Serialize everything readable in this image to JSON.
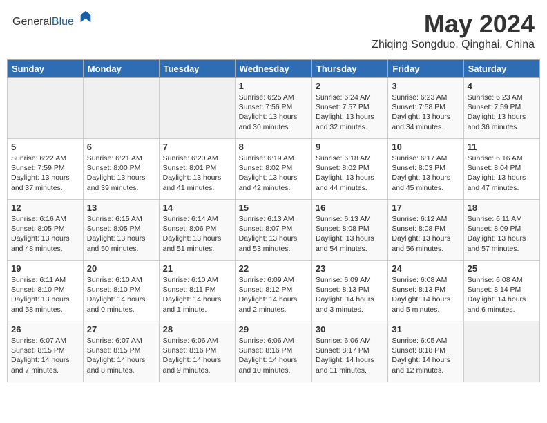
{
  "header": {
    "logo_general": "General",
    "logo_blue": "Blue",
    "month": "May 2024",
    "location": "Zhiqing Songduo, Qinghai, China"
  },
  "weekdays": [
    "Sunday",
    "Monday",
    "Tuesday",
    "Wednesday",
    "Thursday",
    "Friday",
    "Saturday"
  ],
  "weeks": [
    [
      {
        "day": "",
        "info": ""
      },
      {
        "day": "",
        "info": ""
      },
      {
        "day": "",
        "info": ""
      },
      {
        "day": "1",
        "info": "Sunrise: 6:25 AM\nSunset: 7:56 PM\nDaylight: 13 hours\nand 30 minutes."
      },
      {
        "day": "2",
        "info": "Sunrise: 6:24 AM\nSunset: 7:57 PM\nDaylight: 13 hours\nand 32 minutes."
      },
      {
        "day": "3",
        "info": "Sunrise: 6:23 AM\nSunset: 7:58 PM\nDaylight: 13 hours\nand 34 minutes."
      },
      {
        "day": "4",
        "info": "Sunrise: 6:23 AM\nSunset: 7:59 PM\nDaylight: 13 hours\nand 36 minutes."
      }
    ],
    [
      {
        "day": "5",
        "info": "Sunrise: 6:22 AM\nSunset: 7:59 PM\nDaylight: 13 hours\nand 37 minutes."
      },
      {
        "day": "6",
        "info": "Sunrise: 6:21 AM\nSunset: 8:00 PM\nDaylight: 13 hours\nand 39 minutes."
      },
      {
        "day": "7",
        "info": "Sunrise: 6:20 AM\nSunset: 8:01 PM\nDaylight: 13 hours\nand 41 minutes."
      },
      {
        "day": "8",
        "info": "Sunrise: 6:19 AM\nSunset: 8:02 PM\nDaylight: 13 hours\nand 42 minutes."
      },
      {
        "day": "9",
        "info": "Sunrise: 6:18 AM\nSunset: 8:02 PM\nDaylight: 13 hours\nand 44 minutes."
      },
      {
        "day": "10",
        "info": "Sunrise: 6:17 AM\nSunset: 8:03 PM\nDaylight: 13 hours\nand 45 minutes."
      },
      {
        "day": "11",
        "info": "Sunrise: 6:16 AM\nSunset: 8:04 PM\nDaylight: 13 hours\nand 47 minutes."
      }
    ],
    [
      {
        "day": "12",
        "info": "Sunrise: 6:16 AM\nSunset: 8:05 PM\nDaylight: 13 hours\nand 48 minutes."
      },
      {
        "day": "13",
        "info": "Sunrise: 6:15 AM\nSunset: 8:05 PM\nDaylight: 13 hours\nand 50 minutes."
      },
      {
        "day": "14",
        "info": "Sunrise: 6:14 AM\nSunset: 8:06 PM\nDaylight: 13 hours\nand 51 minutes."
      },
      {
        "day": "15",
        "info": "Sunrise: 6:13 AM\nSunset: 8:07 PM\nDaylight: 13 hours\nand 53 minutes."
      },
      {
        "day": "16",
        "info": "Sunrise: 6:13 AM\nSunset: 8:08 PM\nDaylight: 13 hours\nand 54 minutes."
      },
      {
        "day": "17",
        "info": "Sunrise: 6:12 AM\nSunset: 8:08 PM\nDaylight: 13 hours\nand 56 minutes."
      },
      {
        "day": "18",
        "info": "Sunrise: 6:11 AM\nSunset: 8:09 PM\nDaylight: 13 hours\nand 57 minutes."
      }
    ],
    [
      {
        "day": "19",
        "info": "Sunrise: 6:11 AM\nSunset: 8:10 PM\nDaylight: 13 hours\nand 58 minutes."
      },
      {
        "day": "20",
        "info": "Sunrise: 6:10 AM\nSunset: 8:10 PM\nDaylight: 14 hours\nand 0 minutes."
      },
      {
        "day": "21",
        "info": "Sunrise: 6:10 AM\nSunset: 8:11 PM\nDaylight: 14 hours\nand 1 minute."
      },
      {
        "day": "22",
        "info": "Sunrise: 6:09 AM\nSunset: 8:12 PM\nDaylight: 14 hours\nand 2 minutes."
      },
      {
        "day": "23",
        "info": "Sunrise: 6:09 AM\nSunset: 8:13 PM\nDaylight: 14 hours\nand 3 minutes."
      },
      {
        "day": "24",
        "info": "Sunrise: 6:08 AM\nSunset: 8:13 PM\nDaylight: 14 hours\nand 5 minutes."
      },
      {
        "day": "25",
        "info": "Sunrise: 6:08 AM\nSunset: 8:14 PM\nDaylight: 14 hours\nand 6 minutes."
      }
    ],
    [
      {
        "day": "26",
        "info": "Sunrise: 6:07 AM\nSunset: 8:15 PM\nDaylight: 14 hours\nand 7 minutes."
      },
      {
        "day": "27",
        "info": "Sunrise: 6:07 AM\nSunset: 8:15 PM\nDaylight: 14 hours\nand 8 minutes."
      },
      {
        "day": "28",
        "info": "Sunrise: 6:06 AM\nSunset: 8:16 PM\nDaylight: 14 hours\nand 9 minutes."
      },
      {
        "day": "29",
        "info": "Sunrise: 6:06 AM\nSunset: 8:16 PM\nDaylight: 14 hours\nand 10 minutes."
      },
      {
        "day": "30",
        "info": "Sunrise: 6:06 AM\nSunset: 8:17 PM\nDaylight: 14 hours\nand 11 minutes."
      },
      {
        "day": "31",
        "info": "Sunrise: 6:05 AM\nSunset: 8:18 PM\nDaylight: 14 hours\nand 12 minutes."
      },
      {
        "day": "",
        "info": ""
      }
    ]
  ]
}
